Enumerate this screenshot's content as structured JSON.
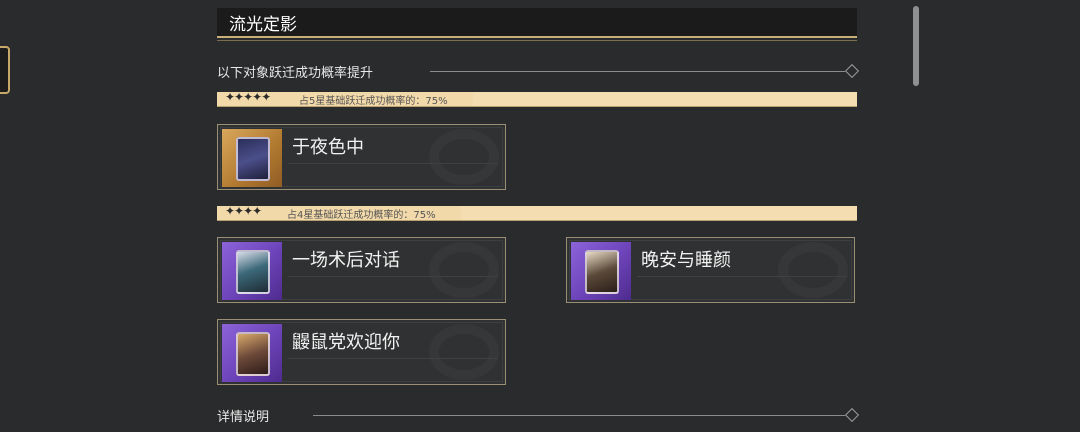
{
  "title": "流光定影",
  "up_section": {
    "label": "以下对象跃迁成功概率提升"
  },
  "five_star": {
    "stars": "✦✦✦✦✦",
    "rate_text": "占5星基础跃迁成功概率的：75%",
    "items": [
      {
        "name": "于夜色中"
      }
    ]
  },
  "four_star": {
    "stars": "✦✦✦✦",
    "rate_text": "占4星基础跃迁成功概率的：75%",
    "items": [
      {
        "name": "一场术后对话"
      },
      {
        "name": "晚安与睡颜"
      },
      {
        "name": "鼹鼠党欢迎你"
      }
    ]
  },
  "details_section": {
    "label": "详情说明"
  },
  "colors": {
    "background": "#2a2b2c",
    "rate_bar": "#f2d9a9",
    "gold_frame": "#c7ad77",
    "five_star_thumb": "#d9a85c",
    "four_star_thumb": "#8d63d9"
  },
  "icons": {
    "left_emblem": "octagon-emblem-icon",
    "section_end": "diamond-icon"
  }
}
